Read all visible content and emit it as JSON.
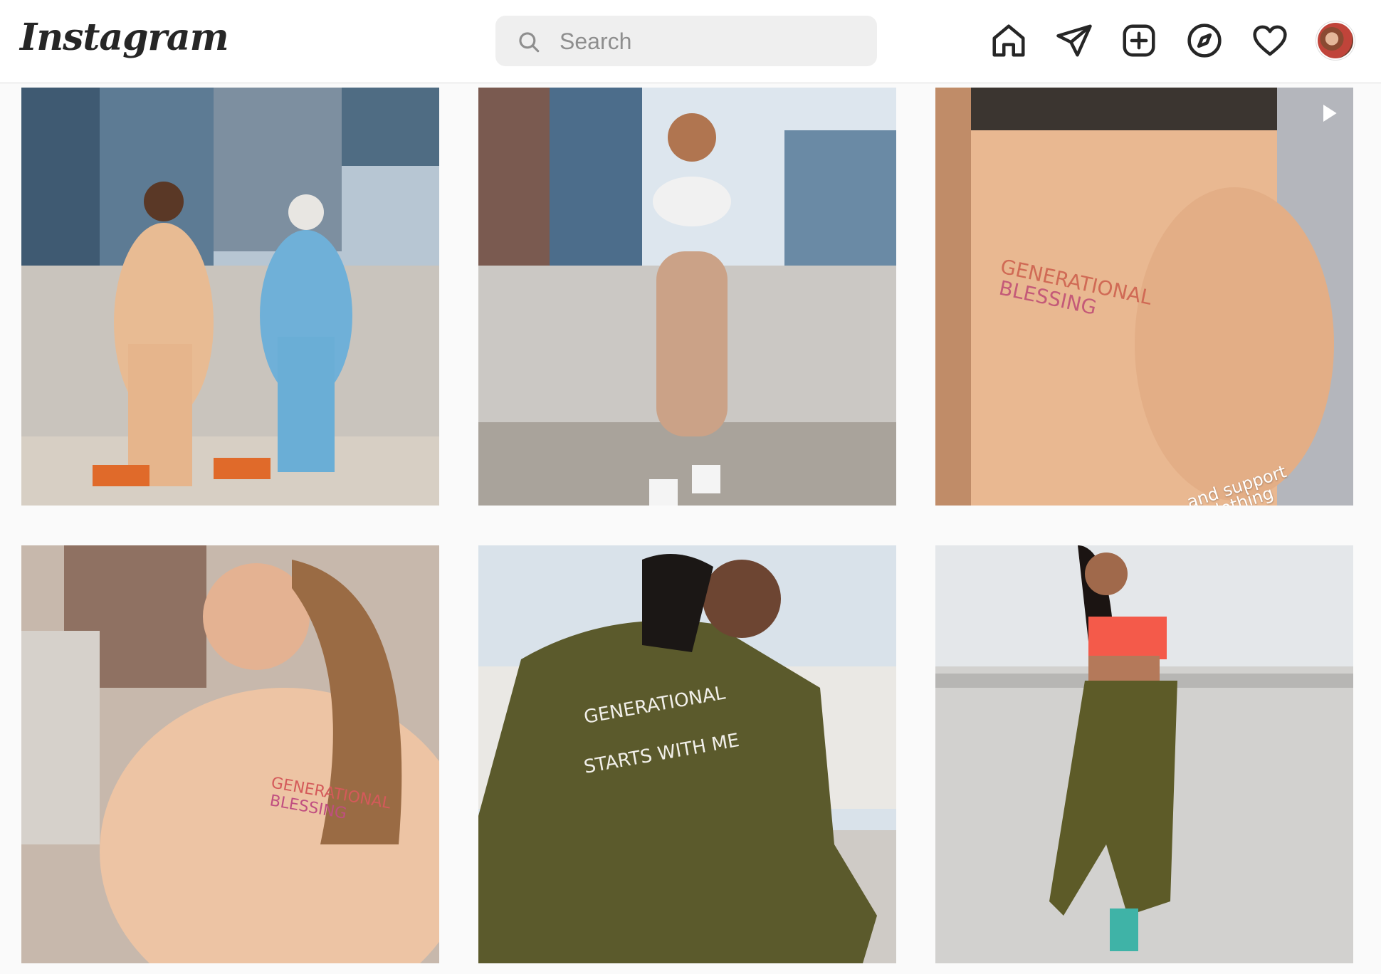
{
  "app": {
    "logo_text": "Instagram"
  },
  "search": {
    "placeholder": "Search"
  },
  "nav": {
    "icons": [
      "home-icon",
      "direct-message-icon",
      "new-post-icon",
      "explore-icon",
      "activity-heart-icon",
      "profile-avatar"
    ]
  },
  "posts": [
    {
      "id_label": "post-1",
      "description_icon": "photo",
      "is_video": false
    },
    {
      "id_label": "post-2",
      "description_icon": "photo",
      "is_video": false
    },
    {
      "id_label": "post-3",
      "description_icon": "video",
      "is_video": true,
      "caption_overlay_1": "and support",
      "caption_overlay_2": "clothing"
    },
    {
      "id_label": "post-4",
      "description_icon": "photo",
      "is_video": false
    },
    {
      "id_label": "post-5",
      "description_icon": "photo",
      "is_video": false
    },
    {
      "id_label": "post-6",
      "description_icon": "photo",
      "is_video": false
    }
  ],
  "colors": {
    "page_bg": "#fafafa",
    "bar_bg": "#ffffff",
    "search_bg": "#efefef",
    "icon": "#262626"
  }
}
